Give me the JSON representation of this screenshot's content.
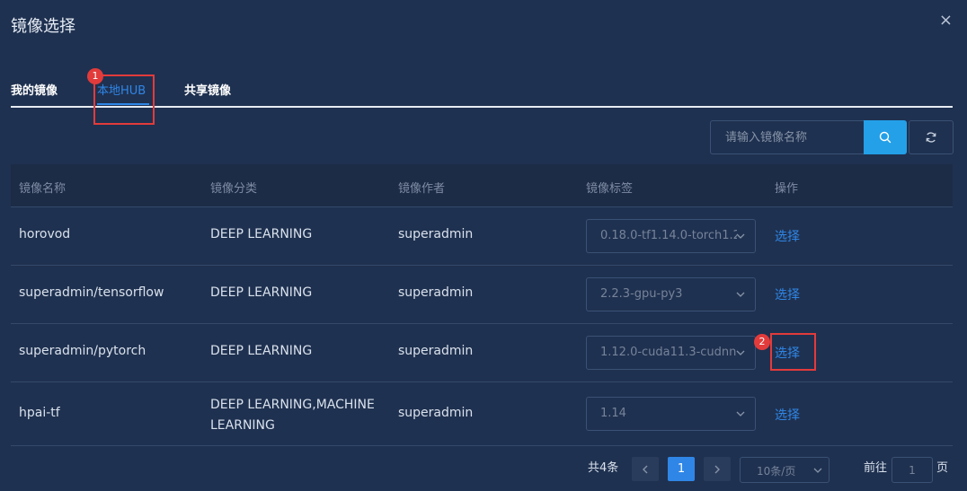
{
  "dialog": {
    "title": "镜像选择",
    "close_icon": "×"
  },
  "tabs": [
    {
      "label": "我的镜像",
      "active": false
    },
    {
      "label": "本地HUB",
      "active": true
    },
    {
      "label": "共享镜像",
      "active": false
    }
  ],
  "annotations": {
    "marker1": "1",
    "marker2": "2",
    "color": "#e23b3b"
  },
  "search": {
    "placeholder": "请输入镜像名称",
    "value": ""
  },
  "table": {
    "headers": [
      "镜像名称",
      "镜像分类",
      "镜像作者",
      "镜像标签",
      "操作"
    ],
    "rows": [
      {
        "name": "horovod",
        "category": "DEEP LEARNING",
        "author": "superadmin",
        "tag": "0.18.0-tf1.14.0-torch1.2",
        "action": "选择"
      },
      {
        "name": "superadmin/tensorflow",
        "category": "DEEP LEARNING",
        "author": "superadmin",
        "tag": "2.2.3-gpu-py3",
        "action": "选择"
      },
      {
        "name": "superadmin/pytorch",
        "category": "DEEP LEARNING",
        "author": "superadmin",
        "tag": "1.12.0-cuda11.3-cudnn",
        "action": "选择"
      },
      {
        "name": "hpai-tf",
        "category_line1": "DEEP LEARNING,MACHINE",
        "category_line2": "LEARNING",
        "author": "superadmin",
        "tag": "1.14",
        "action": "选择"
      }
    ]
  },
  "pagination": {
    "total": "共4条",
    "current_page": "1",
    "page_size": "10条/页",
    "goto_prefix": "前往",
    "goto_value": "1",
    "goto_suffix": "页"
  },
  "colors": {
    "accent": "#2f86e6",
    "background": "#1f3150",
    "search_button": "#23a0e8"
  }
}
